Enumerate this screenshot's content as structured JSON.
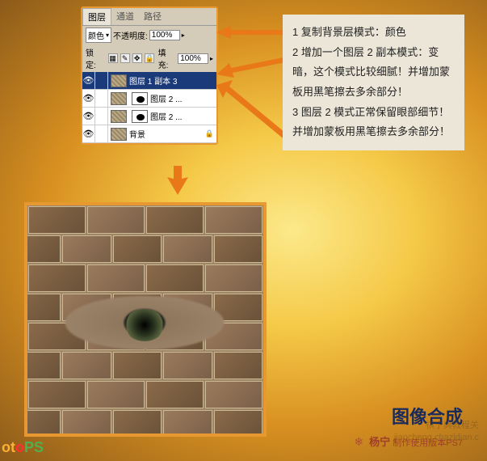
{
  "panel": {
    "tabs": [
      "图层",
      "通道",
      "路径"
    ],
    "active_tab": 0,
    "blend_label": "颜色",
    "opacity_label": "不透明度:",
    "opacity_value": "100%",
    "lock_label": "锁定:",
    "fill_label": "填充:",
    "fill_value": "100%",
    "layers": [
      {
        "name": "图层 1 副本 3",
        "selected": true,
        "eye": true,
        "mask": false
      },
      {
        "name": "图层 2 ...",
        "selected": false,
        "eye": true,
        "mask": true
      },
      {
        "name": "图层 2 ...",
        "selected": false,
        "eye": true,
        "mask": true
      },
      {
        "name": "背景",
        "selected": false,
        "eye": true,
        "mask": false,
        "locked": true
      }
    ]
  },
  "instructions": {
    "line1": "1 复制背景层模式：颜色",
    "line2": "2 增加一个图层 2 副本模式：变暗，这个模式比较细腻！并增加蒙板用黑笔擦去多余部分！",
    "line3": "3 图层 2 模式正常保留眼部细节！并增加蒙板用黑笔擦去多余部分！"
  },
  "footer": {
    "title": "图像合成",
    "signature": "杨宁",
    "subtitle": "制作使用版本PS7"
  },
  "logo": {
    "p1": "ot",
    "p2": "o",
    "p3": "PS"
  },
  "watermark": {
    "t1": "祺宁典教程关",
    "t2": "jiaocheng.chazidian.c"
  }
}
